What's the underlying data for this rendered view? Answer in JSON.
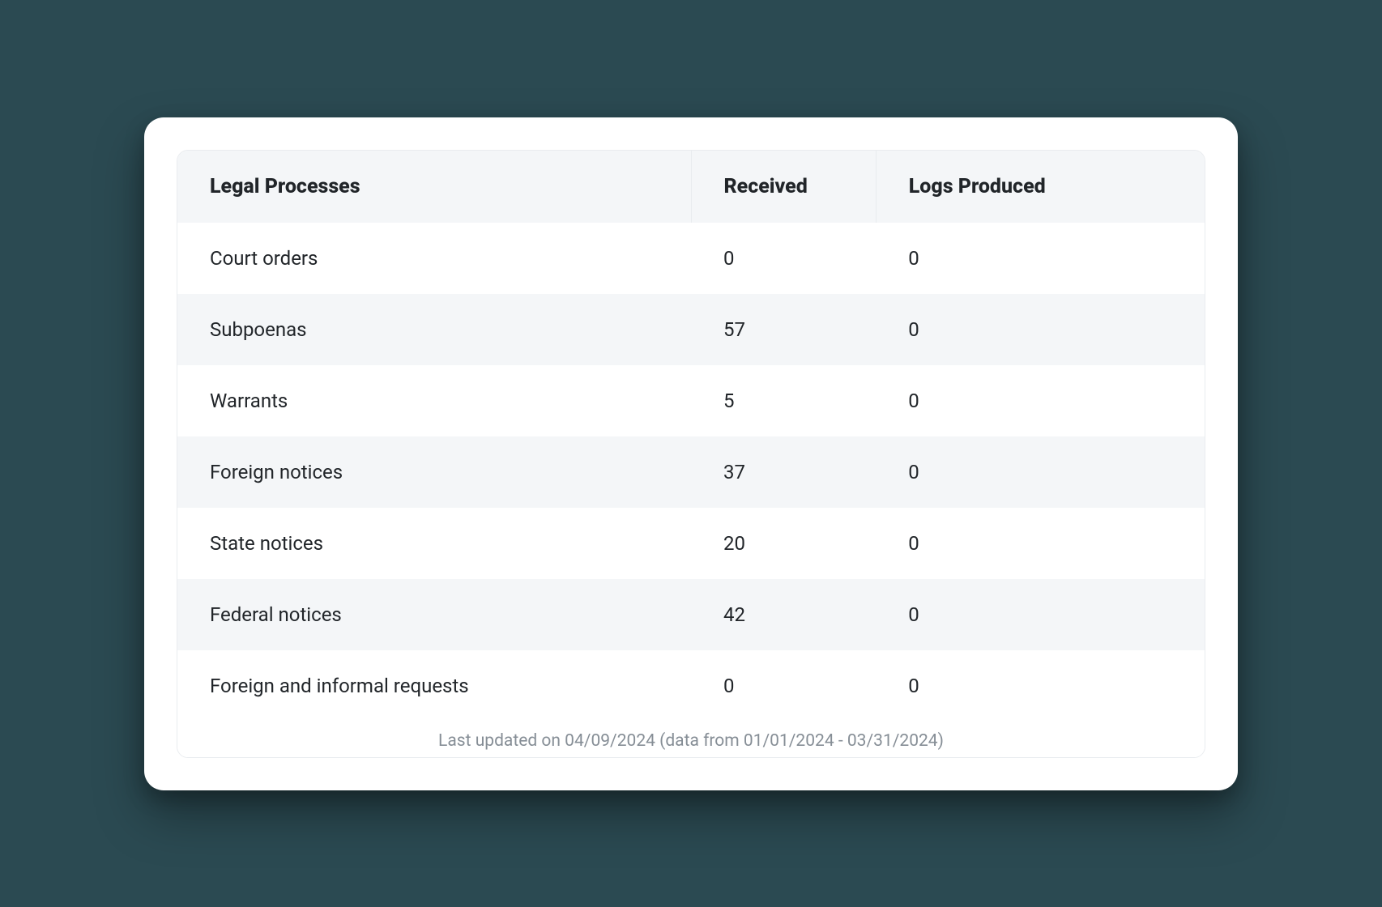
{
  "chart_data": {
    "type": "table",
    "columns": [
      "Legal Processes",
      "Received",
      "Logs Produced"
    ],
    "rows": [
      {
        "process": "Court orders",
        "received": 0,
        "logs_produced": 0
      },
      {
        "process": "Subpoenas",
        "received": 57,
        "logs_produced": 0
      },
      {
        "process": "Warrants",
        "received": 5,
        "logs_produced": 0
      },
      {
        "process": "Foreign notices",
        "received": 37,
        "logs_produced": 0
      },
      {
        "process": "State notices",
        "received": 20,
        "logs_produced": 0
      },
      {
        "process": "Federal notices",
        "received": 42,
        "logs_produced": 0
      },
      {
        "process": "Foreign and informal requests",
        "received": 0,
        "logs_produced": 0
      }
    ]
  },
  "footer_text": "Last updated on 04/09/2024 (data from 01/01/2024 - 03/31/2024)"
}
